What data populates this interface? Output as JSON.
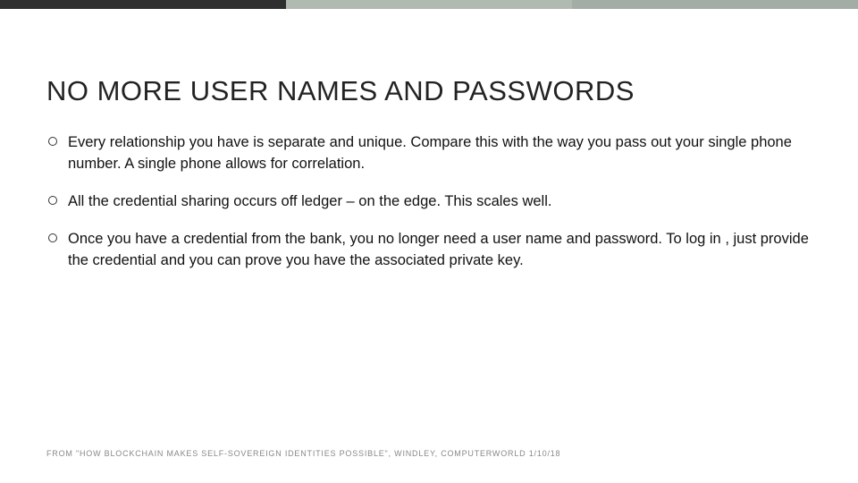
{
  "accent_colors": {
    "bar1": "#2f2f2f",
    "bar2": "#b1bab1",
    "bar3": "#a3ada6"
  },
  "slide": {
    "title": "NO MORE USER NAMES AND PASSWORDS",
    "bullets": [
      "Every relationship you have is separate and unique. Compare this with the way you pass out your single phone number. A single phone allows for correlation.",
      "All the credential sharing occurs off ledger – on the edge. This scales well.",
      "Once you have a credential from the bank, you no longer need a user name and password. To log in , just provide the credential and you can prove you have the associated private key."
    ],
    "footer": "FROM \"HOW BLOCKCHAIN MAKES SELF-SOVEREIGN IDENTITIES POSSIBLE\", WINDLEY, COMPUTERWORLD 1/10/18"
  }
}
